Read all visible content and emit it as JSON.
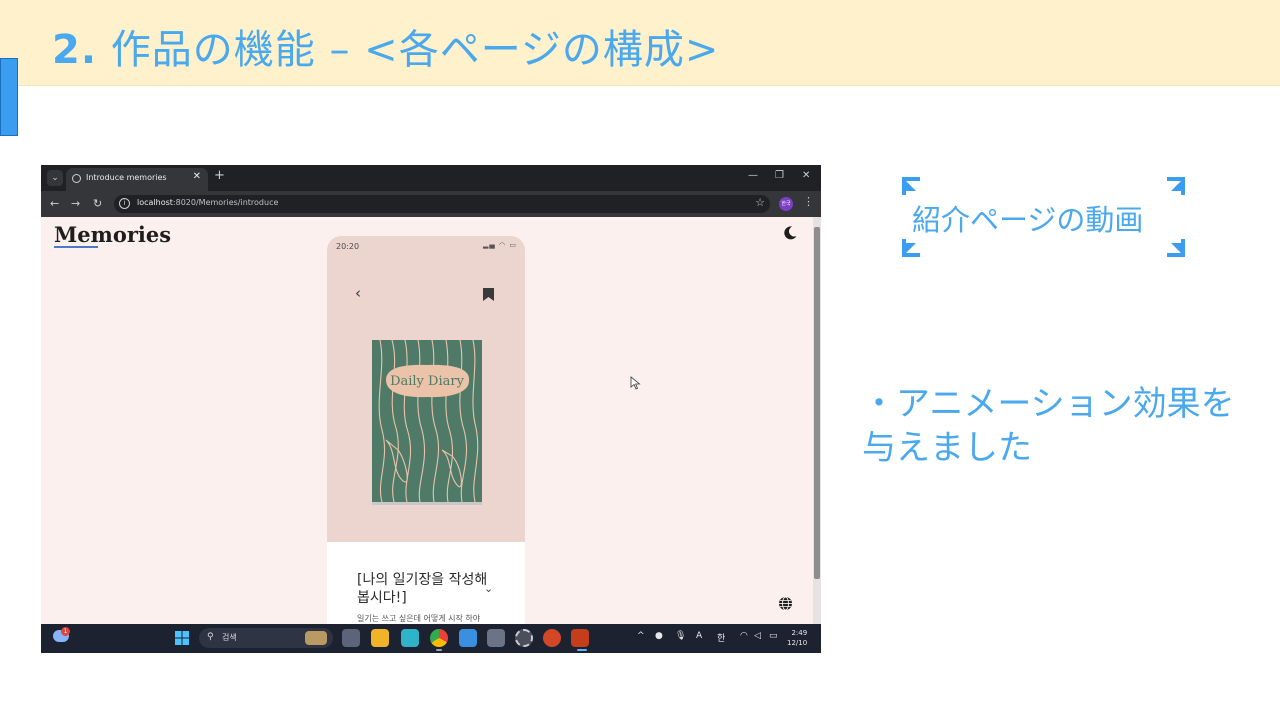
{
  "slide": {
    "title_num": "2.",
    "title_text": "作品の機能 – <各ページの構成>",
    "video_label": "紹介ページの動画",
    "note": "・アニメーション効果を与えました"
  },
  "browser": {
    "tab_title": "Introduce memories",
    "url_host": "localhost",
    "url_rest": ":8020/Memories/introduce",
    "profile_label": "한국"
  },
  "page": {
    "logo": "Memories",
    "phone": {
      "time": "20:20",
      "book_title": "Daily Diary",
      "heading": "[나의 일기장을 작성해봅시다!]",
      "subtext": "일기는 쓰고 싶은데 어떻게 시작 하야"
    }
  },
  "taskbar": {
    "search_placeholder": "검색",
    "weather_badge": "1",
    "ime_a": "A",
    "ime_han": "한",
    "clock_time": "2:49",
    "clock_date": "12/10"
  },
  "colors": {
    "accent": "#4aa8ee",
    "header_bg": "#fef1cc",
    "page_bg": "#fcf0ef",
    "book_green": "#4f7a68",
    "book_label": "#eac3a8"
  }
}
